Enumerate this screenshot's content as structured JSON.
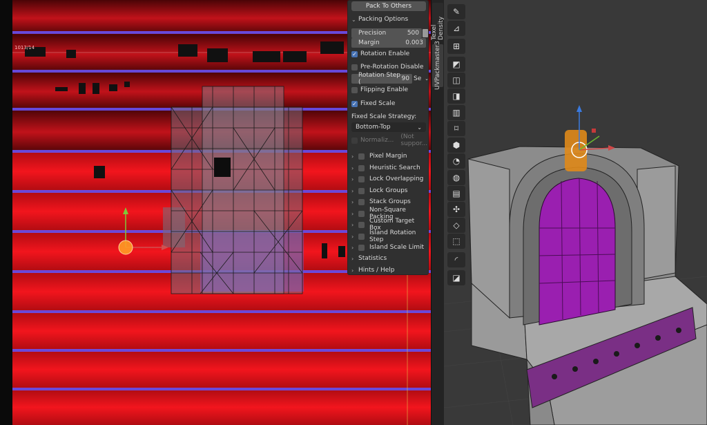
{
  "uv_editor": {
    "coord_readout": "1013/14"
  },
  "side_tabs": {
    "texel_density": "Texel Density",
    "uvpackmaster": "UVPackmaster3"
  },
  "panel": {
    "pack_to_others": "Pack To Others",
    "packing_options": "Packing Options",
    "precision_label": "Precision",
    "precision_value": "500",
    "margin_label": "Margin",
    "margin_value": "0.003",
    "rotation_enable": "Rotation Enable",
    "pre_rotation_disable": "Pre-Rotation Disable",
    "rotation_step_label": "Rotation Step (",
    "rotation_step_value": "90",
    "rotation_step_suffix": "Se",
    "flipping_enable": "Flipping Enable",
    "fixed_scale": "Fixed Scale",
    "fixed_scale_strategy_label": "Fixed Scale Strategy:",
    "fixed_scale_strategy_value": "Bottom-Top",
    "normalize_label": "Normaliz...",
    "normalize_note": "(Not suppor...",
    "sections": [
      "Pixel Margin",
      "Heuristic Search",
      "Lock Overlapping",
      "Lock Groups",
      "Stack Groups",
      "Non-Square Packing",
      "Custom Target Box",
      "Island Rotation Step",
      "Island Scale Limit"
    ],
    "statistics": "Statistics",
    "hints_help": "Hints / Help"
  },
  "checkbox_state": {
    "rotation_enable": true,
    "pre_rotation_disable": false,
    "flipping_enable": false,
    "fixed_scale": true,
    "normalize": false
  },
  "tools": [
    "annotate-icon",
    "measure-icon",
    "add-cube-icon",
    "extrude-icon",
    "inset-icon",
    "bevel-icon",
    "loop-cut-icon",
    "knife-icon",
    "poly-build-icon",
    "spin-icon",
    "smooth-icon",
    "edge-slide-icon",
    "shrink-icon",
    "shear-icon",
    "rip-region-icon",
    "transform-icon",
    "corner-icon"
  ],
  "colors": {
    "accent": "#4772b3",
    "panel_bg": "#303030",
    "uv_red": "#e0141c",
    "window_purple": "#9a1fb0"
  }
}
